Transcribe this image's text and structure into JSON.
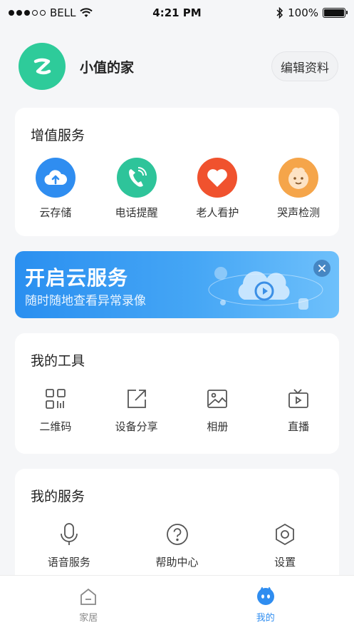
{
  "status_bar": {
    "carrier": "BELL",
    "time": "4:21 PM",
    "battery": "100%"
  },
  "profile": {
    "name": "小值的家",
    "edit_label": "编辑资料",
    "avatar_color": "#2ecb9a"
  },
  "value_services": {
    "title": "增值服务",
    "items": [
      {
        "label": "云存储",
        "icon": "cloud-upload-icon",
        "color": "#2f8df0"
      },
      {
        "label": "电话提醒",
        "icon": "phone-icon",
        "color": "#2ec49a"
      },
      {
        "label": "老人看护",
        "icon": "heart-icon",
        "color": "#f0522e"
      },
      {
        "label": "哭声检测",
        "icon": "baby-face-icon",
        "color": "#f5a54a"
      }
    ]
  },
  "banner": {
    "title": "开启云服务",
    "subtitle": "随时随地查看异常录像"
  },
  "my_tools": {
    "title": "我的工具",
    "items": [
      {
        "label": "二维码",
        "icon": "qr-code-icon"
      },
      {
        "label": "设备分享",
        "icon": "share-icon"
      },
      {
        "label": "相册",
        "icon": "album-icon"
      },
      {
        "label": "直播",
        "icon": "live-tv-icon"
      }
    ]
  },
  "my_services": {
    "title": "我的服务",
    "items": [
      {
        "label": "语音服务",
        "icon": "microphone-icon"
      },
      {
        "label": "帮助中心",
        "icon": "help-icon"
      },
      {
        "label": "设置",
        "icon": "settings-icon"
      }
    ]
  },
  "tab_bar": {
    "tabs": [
      {
        "label": "家居",
        "icon": "home-icon",
        "active": false
      },
      {
        "label": "我的",
        "icon": "profile-face-icon",
        "active": true
      }
    ],
    "accent": "#2f8df0"
  }
}
